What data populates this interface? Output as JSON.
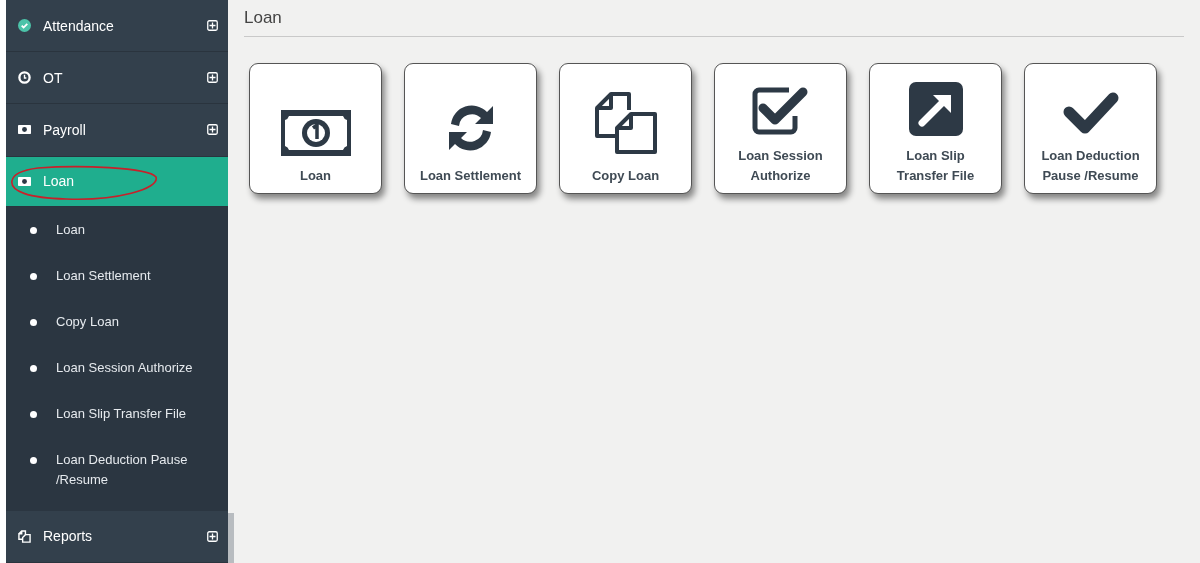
{
  "sidebar": {
    "items": [
      {
        "label": "Attendance",
        "selected": false,
        "circled": false
      },
      {
        "label": "OT",
        "selected": false,
        "circled": false
      },
      {
        "label": "Payroll",
        "selected": false,
        "circled": false
      },
      {
        "label": "Loan",
        "selected": true,
        "circled": true,
        "children": [
          {
            "label": "Loan"
          },
          {
            "label": "Loan Settlement"
          },
          {
            "label": "Copy Loan"
          },
          {
            "label": "Loan Session Authorize"
          },
          {
            "label": "Loan Slip Transfer File"
          },
          {
            "label": "Loan Deduction Pause /Resume"
          }
        ]
      },
      {
        "label": "Reports",
        "selected": false,
        "circled": false
      }
    ]
  },
  "page": {
    "title": "Loan"
  },
  "tiles": [
    {
      "label": "Loan"
    },
    {
      "label": "Loan Settlement"
    },
    {
      "label": "Copy Loan"
    },
    {
      "label": "Loan Session Authorize"
    },
    {
      "label": "Loan Slip Transfer File"
    },
    {
      "label": "Loan Deduction Pause /Resume"
    }
  ]
}
